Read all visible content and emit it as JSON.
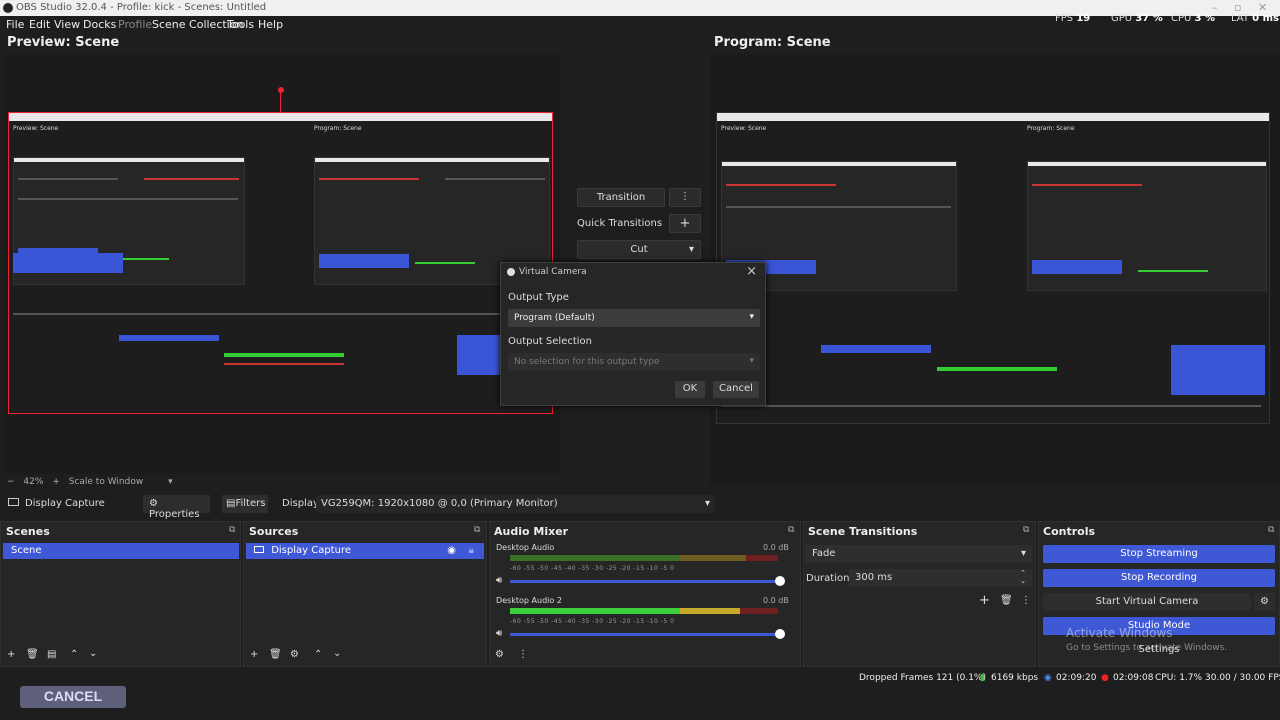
{
  "window": {
    "title": "OBS Studio 32.0.4 - Profile: kick - Scenes: Untitled"
  },
  "menu": [
    "File",
    "Edit",
    "View",
    "Docks",
    "Profile",
    "Scene Collection",
    "Tools",
    "Help"
  ],
  "stats": {
    "fps_label": "FPS",
    "fps": "19",
    "gpu_label": "GPU",
    "gpu": "37 %",
    "cpu_label": "CPU",
    "cpu": "3 %",
    "lat_label": "LAT",
    "lat": "0 ms"
  },
  "preview": {
    "title": "Preview: Scene",
    "zoom": "42%",
    "scale_mode": "Scale to Window"
  },
  "program": {
    "title": "Program: Scene"
  },
  "nested": {
    "preview_label": "Preview: Scene",
    "program_label": "Program: Scene"
  },
  "transitions_col": {
    "transition": "Transition",
    "quick": "Quick Transitions",
    "cut": "Cut"
  },
  "dialog": {
    "title": "Virtual Camera",
    "output_type_label": "Output Type",
    "output_type_value": "Program (Default)",
    "output_selection_label": "Output Selection",
    "output_selection_placeholder": "No selection for this output type",
    "ok": "OK",
    "cancel": "Cancel"
  },
  "source_toolbar": {
    "source": "Display Capture",
    "properties": "Properties",
    "filters": "Filters",
    "display_label": "Display",
    "display_value": "VG259QM: 1920x1080 @ 0,0 (Primary Monitor)"
  },
  "scenes": {
    "title": "Scenes",
    "items": [
      "Scene"
    ]
  },
  "sources": {
    "title": "Sources",
    "items": [
      "Display Capture"
    ]
  },
  "audio": {
    "title": "Audio Mixer",
    "channels": [
      {
        "name": "Desktop Audio",
        "db": "0.0 dB"
      },
      {
        "name": "Desktop Audio 2",
        "db": "0.0 dB"
      }
    ],
    "ticks": "-60  -55  -50  -45  -40  -35  -30  -25  -20  -15  -10  -5  0"
  },
  "scene_transitions": {
    "title": "Scene Transitions",
    "type": "Fade",
    "duration_label": "Duration",
    "duration": "300 ms"
  },
  "controls": {
    "title": "Controls",
    "stop_streaming": "Stop Streaming",
    "stop_recording": "Stop Recording",
    "start_virtual_camera": "Start Virtual Camera",
    "studio_mode": "Studio Mode",
    "settings": "Settings"
  },
  "watermark": {
    "line1": "Activate Windows",
    "line2": "Go to Settings to activate Windows."
  },
  "statusbar": {
    "dropped": "Dropped Frames 121 (0.1%)",
    "bitrate": "6169 kbps",
    "stream_time": "02:09:20",
    "rec_time": "02:09:08",
    "cpu": "CPU: 1.7%",
    "fps": "30.00 / 30.00 FPS"
  },
  "overlay": {
    "cancel": "CANCEL"
  },
  "colors": {
    "accent": "#3f58d6",
    "selection": "#e22233",
    "background": "#1e1e1e"
  }
}
